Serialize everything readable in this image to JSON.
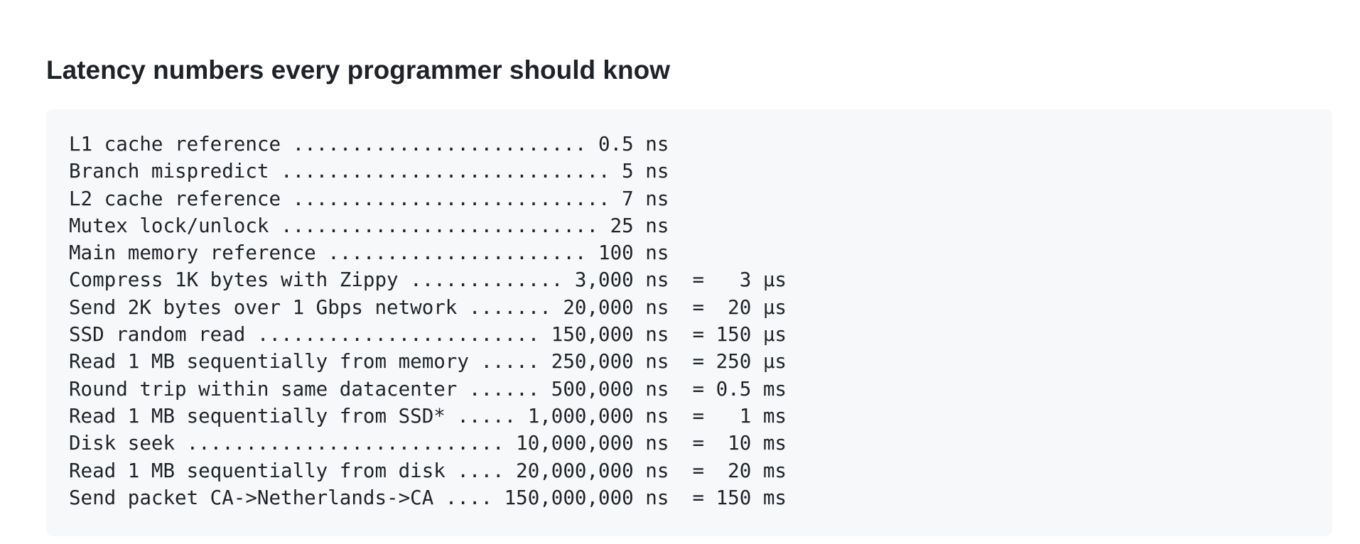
{
  "title": "Latency numbers every programmer should know",
  "lines": [
    "L1 cache reference ......................... 0.5 ns",
    "Branch mispredict ............................ 5 ns",
    "L2 cache reference ........................... 7 ns",
    "Mutex lock/unlock ........................... 25 ns",
    "Main memory reference ...................... 100 ns",
    "Compress 1K bytes with Zippy ............. 3,000 ns  =   3 µs",
    "Send 2K bytes over 1 Gbps network ....... 20,000 ns  =  20 µs",
    "SSD random read ........................ 150,000 ns  = 150 µs",
    "Read 1 MB sequentially from memory ..... 250,000 ns  = 250 µs",
    "Round trip within same datacenter ...... 500,000 ns  = 0.5 ms",
    "Read 1 MB sequentially from SSD* ..... 1,000,000 ns  =   1 ms",
    "Disk seek ........................... 10,000,000 ns  =  10 ms",
    "Read 1 MB sequentially from disk .... 20,000,000 ns  =  20 ms",
    "Send packet CA->Netherlands->CA .... 150,000,000 ns  = 150 ms"
  ]
}
